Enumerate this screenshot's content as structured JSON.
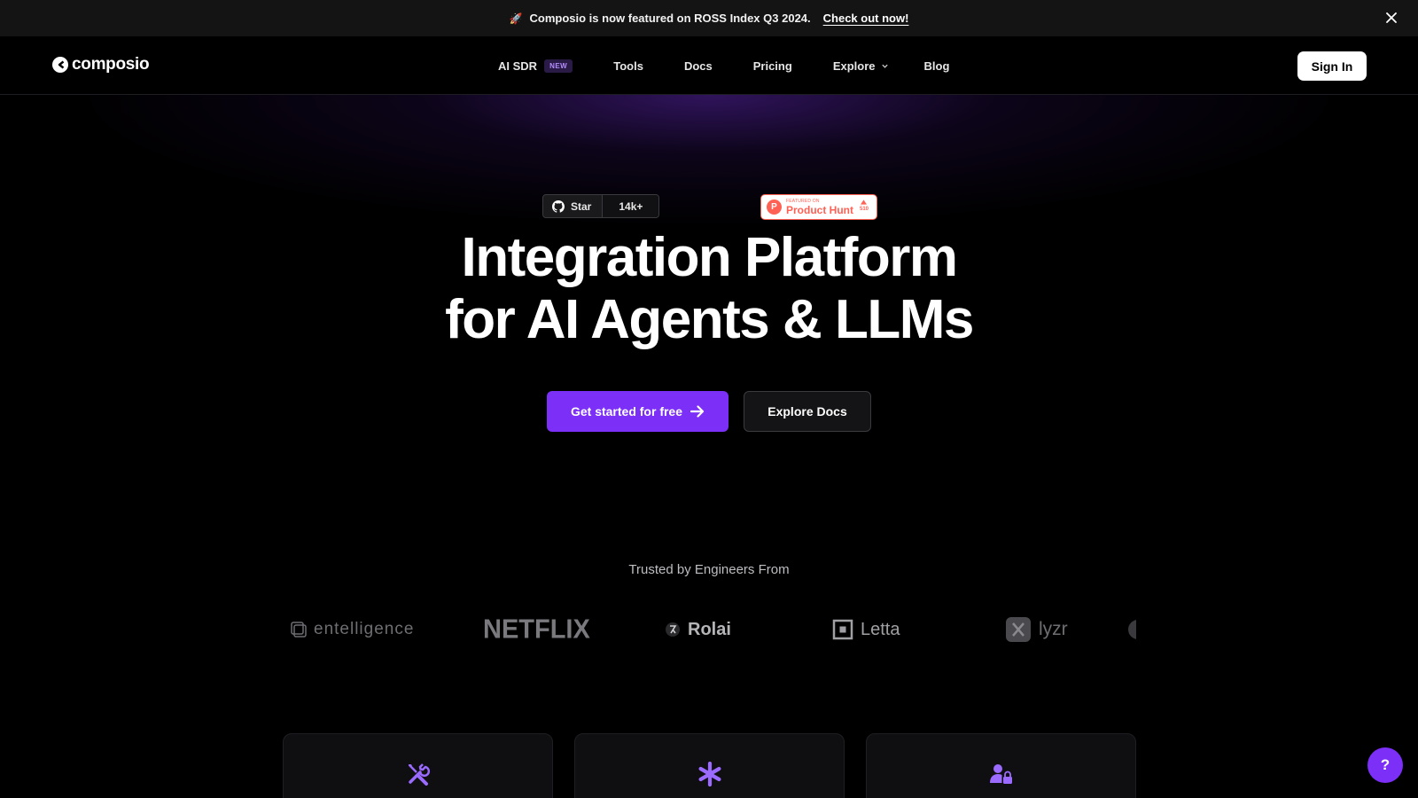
{
  "announcement": {
    "icon": "rocket-icon",
    "text": "Composio is now featured on ROSS Index Q3 2024.",
    "cta": "Check out now!"
  },
  "nav": {
    "brand": "composio",
    "items": [
      {
        "label": "AI SDR",
        "badge": "NEW"
      },
      {
        "label": "Tools"
      },
      {
        "label": "Docs"
      },
      {
        "label": "Pricing"
      },
      {
        "label": "Explore"
      },
      {
        "label": "Blog"
      }
    ],
    "sign_in": "Sign In"
  },
  "github": {
    "star_label": "Star",
    "count": "14k+"
  },
  "product_hunt": {
    "small": "FEATURED ON",
    "name": "Product Hunt",
    "votes": "510"
  },
  "hero": {
    "line1": "Integration Platform",
    "line2": "for AI Agents & LLMs",
    "primary_cta": "Get started for free",
    "secondary_cta": "Explore Docs"
  },
  "trusted": {
    "heading": "Trusted by Engineers From",
    "logos": [
      "entelligence",
      "NETFLIX",
      "Rolai",
      "Letta",
      "lyzr"
    ]
  },
  "cards": [
    {
      "icon": "tools-icon"
    },
    {
      "icon": "asterisk-icon"
    },
    {
      "icon": "user-lock-icon"
    }
  ],
  "help": {
    "label": "?"
  },
  "colors": {
    "accent": "#7b2ff7",
    "background": "#000000"
  }
}
